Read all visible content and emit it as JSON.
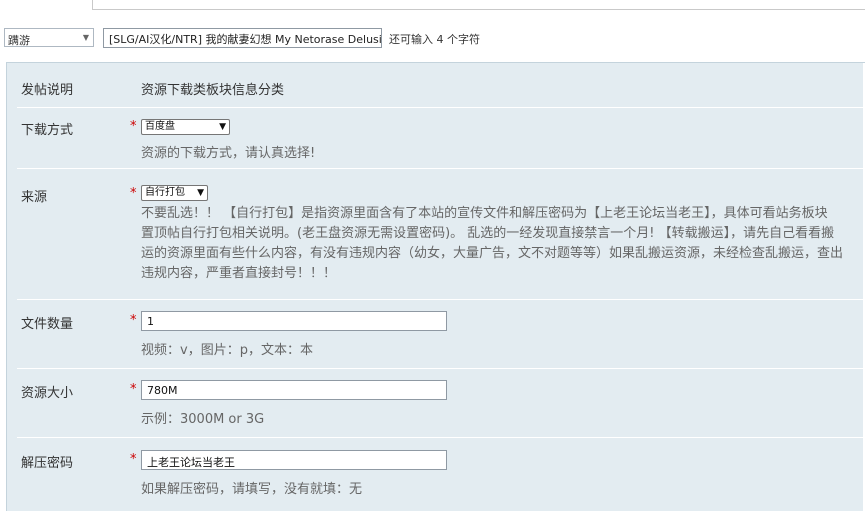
{
  "thread_type": {
    "selected": "蹒游"
  },
  "subject": {
    "value": "[SLG/AI汉化/NTR] 我的献妻幻想 My Netorase Delusions",
    "remaining": "还可输入 4 个字符"
  },
  "fields": {
    "intro": {
      "label": "发帖说明",
      "value": "资源下载类板块信息分类"
    },
    "download": {
      "label": "下载方式",
      "selected": "百度盘",
      "hint": "资源的下载方式，请认真选择!"
    },
    "source": {
      "label": "来源",
      "selected": "自行打包",
      "desc_lines": [
        "不要乱选！！ 【自行打包】是指资源里面含有了本站的宣传文件和解压密码为【上老王论坛当老王】，具体可看站务板块",
        "置顶帖自行打包相关说明。(老王盘资源无需设置密码)。 乱选的一经发现直接禁言一个月! 【转载搬运】，请先自己看看搬",
        "运的资源里面有些什么内容，有没有违规内容（幼女，大量广告，文不对题等等）如果乱搬运资源，未经检查乱搬运，查出",
        "违规内容，严重者直接封号！！！"
      ]
    },
    "file_count": {
      "label": "文件数量",
      "value": "1",
      "hint": "视频：v，图片：p，文本：本"
    },
    "size": {
      "label": "资源大小",
      "value": "780M",
      "hint": "示例：3000M or 3G"
    },
    "password": {
      "label": "解压密码",
      "value": "上老王论坛当老王",
      "hint": "如果解压密码，请填写，没有就填：无"
    }
  },
  "required_mark": "*",
  "icons": {
    "dropdown": "chevron-down-icon"
  },
  "colors": {
    "panel_bg": "#e3ecf1",
    "required": "#cc0000",
    "hint_text": "#666666"
  }
}
